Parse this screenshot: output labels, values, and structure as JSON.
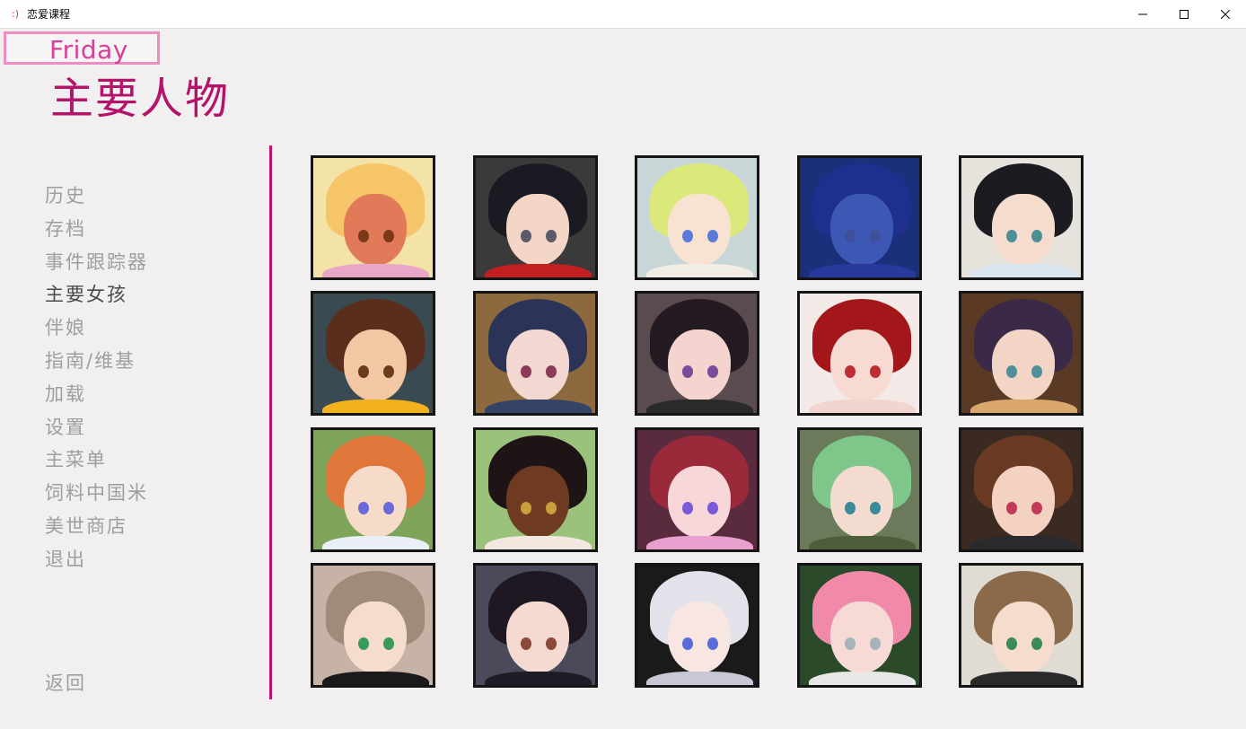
{
  "window": {
    "title": "恋爱课程",
    "app_icon": ":)",
    "controls": [
      "minimize",
      "maximize",
      "close"
    ]
  },
  "day": "Friday",
  "page_title": "主要人物",
  "menu": {
    "items": [
      {
        "label": "历史",
        "active": false
      },
      {
        "label": "存档",
        "active": false
      },
      {
        "label": "事件跟踪器",
        "active": false
      },
      {
        "label": "主要女孩",
        "active": true
      },
      {
        "label": "伴娘",
        "active": false
      },
      {
        "label": "指南/维基",
        "active": false
      },
      {
        "label": "加载",
        "active": false
      },
      {
        "label": "设置",
        "active": false
      },
      {
        "label": "主菜单",
        "active": false
      },
      {
        "label": "饲料中国米",
        "active": false
      },
      {
        "label": "美世商店",
        "active": false
      },
      {
        "label": "退出",
        "active": false
      }
    ],
    "back": "返回"
  },
  "colors": {
    "accent": "#c0136b",
    "title": "#b3146a",
    "day_border": "#ee8dc0",
    "menu_inactive": "#9e9e9e",
    "menu_active": "#4a4a4a"
  },
  "portraits": [
    {
      "bg": "#f3e3a6",
      "hair": "#f6c56a",
      "skin": "#e07a58",
      "eye": "#7a3a1a",
      "body": "#e9a6c7"
    },
    {
      "bg": "#3a3a3a",
      "hair": "#1a1a22",
      "skin": "#f3d6c6",
      "eye": "#5a5a6a",
      "body": "#c22020"
    },
    {
      "bg": "#c9d6d8",
      "hair": "#dbe97a",
      "skin": "#f8e2d2",
      "eye": "#5b7bd8",
      "body": "#f1ece4"
    },
    {
      "bg": "#1b2f7a",
      "hair": "#1e2f8e",
      "skin": "#3d58b4",
      "eye": "#3f4f9a",
      "body": "#283a9e"
    },
    {
      "bg": "#e6e2dc",
      "hair": "#1c1b22",
      "skin": "#f6dccd",
      "eye": "#4c8f95",
      "body": "#d9e6ef"
    },
    {
      "bg": "#3a4a52",
      "hair": "#5a2e1c",
      "skin": "#f2c7a3",
      "eye": "#6b3b1b",
      "body": "#f2b21e"
    },
    {
      "bg": "#8d6a3e",
      "hair": "#2b3456",
      "skin": "#f3d7d1",
      "eye": "#8b3a5a",
      "body": "#354466"
    },
    {
      "bg": "#5a4b4e",
      "hair": "#241a22",
      "skin": "#f5d3cf",
      "eye": "#7a4c9a",
      "body": "#2a2a2a"
    },
    {
      "bg": "#f3e9e6",
      "hair": "#a3171b",
      "skin": "#f7dad2",
      "eye": "#c12b34",
      "body": "#f3d5cf"
    },
    {
      "bg": "#5a3a24",
      "hair": "#3b2a47",
      "skin": "#f3d5c6",
      "eye": "#4f8f9a",
      "body": "#d9a86a"
    },
    {
      "bg": "#7ea45a",
      "hair": "#e0763a",
      "skin": "#f7dbc9",
      "eye": "#6a6ad8",
      "body": "#eaeef6"
    },
    {
      "bg": "#9bc27a",
      "hair": "#1e1416",
      "skin": "#6e3a22",
      "eye": "#c9a03a",
      "body": "#f3e8e0"
    },
    {
      "bg": "#5a2a3e",
      "hair": "#9a2a3a",
      "skin": "#f7d7d9",
      "eye": "#7a5ad8",
      "body": "#e8a0cf"
    },
    {
      "bg": "#6a7a5a",
      "hair": "#7fc68a",
      "skin": "#f3dccf",
      "eye": "#3a8a9a",
      "body": "#4e5e3a"
    },
    {
      "bg": "#3a2a22",
      "hair": "#6a3b22",
      "skin": "#f3d2c2",
      "eye": "#c23a5a",
      "body": "#2a2a2e"
    },
    {
      "bg": "#c7b3a6",
      "hair": "#a08a7a",
      "skin": "#f6dccd",
      "eye": "#3a9a5a",
      "body": "#1a1a1a"
    },
    {
      "bg": "#4a4a5a",
      "hair": "#1f1822",
      "skin": "#f5dad2",
      "eye": "#8a4a3a",
      "body": "#1d1d25"
    },
    {
      "bg": "#1a1a1a",
      "hair": "#e2e2ea",
      "skin": "#f7e6e2",
      "eye": "#5a6ad8",
      "body": "#c7c7d6"
    },
    {
      "bg": "#2a4a2a",
      "hair": "#f08aa8",
      "skin": "#f7dad6",
      "eye": "#a6b3b8",
      "body": "#e8e8e8"
    },
    {
      "bg": "#e0dcd4",
      "hair": "#8a6a4a",
      "skin": "#f6dccc",
      "eye": "#3a8a5a",
      "body": "#2a2a2a"
    }
  ]
}
